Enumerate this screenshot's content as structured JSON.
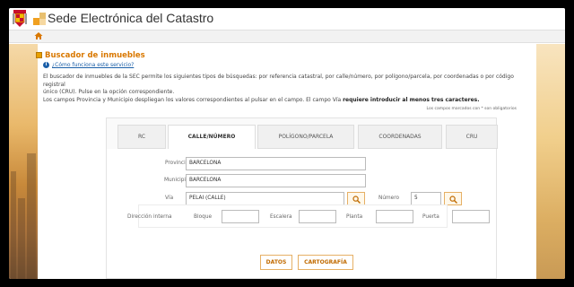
{
  "header": {
    "title": "Sede Electrónica del Catastro"
  },
  "nav": {
    "home_icon": "home-icon"
  },
  "colors": {
    "accent": "#d97800",
    "link": "#1a5fa8",
    "button_border": "#e6b065"
  },
  "section": {
    "title": "Buscador de inmuebles",
    "howto_link": "¿Cómo funciona este servicio?",
    "desc_line1": "El buscador de inmuebles de la SEC permite los siguientes tipos de búsquedas: por referencia catastral, por calle/número, por polígono/parcela, por coordenadas o por código registral",
    "desc_line2": "único (CRU). Pulse en la opción correspondiente.",
    "desc_line3_pre": "Los campos Provincia y Municipio despliegan los valores correspondientes al pulsar en el campo. El campo Vía ",
    "desc_line3_bold": "requiere introducir al menos tres caracteres.",
    "required_note": "Los campos marcados con * son obligatorios"
  },
  "tabs": [
    {
      "label": "RC"
    },
    {
      "label": "CALLE/NÚMERO"
    },
    {
      "label": "POLÍGONO/PARCELA"
    },
    {
      "label": "COORDENADAS"
    },
    {
      "label": "CRU"
    }
  ],
  "form": {
    "provincia_label": "Provincia",
    "provincia_value": "BARCELONA",
    "municipio_label": "Municipio",
    "municipio_value": "BARCELONA",
    "via_label": "Vía",
    "via_value": "PELAI (CALLE)",
    "numero_label": "Número",
    "numero_value": "5",
    "direccion_label": "Dirección interna",
    "bloque_label": "Bloque",
    "escalera_label": "Escalera",
    "planta_label": "Planta",
    "puerta_label": "Puerta",
    "bloque_value": "",
    "escalera_value": "",
    "planta_value": "",
    "puerta_value": ""
  },
  "buttons": {
    "datos": "DATOS",
    "cartografia": "CARTOGRAFÍA"
  }
}
